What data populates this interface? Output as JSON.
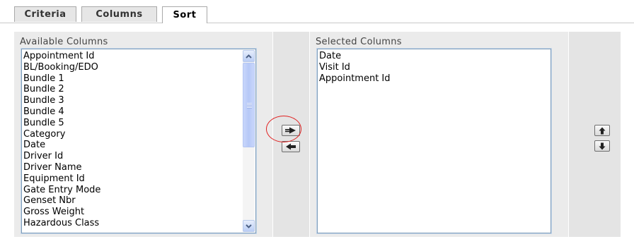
{
  "tabs": [
    {
      "label": "Criteria"
    },
    {
      "label": "Columns"
    },
    {
      "label": "Sort"
    }
  ],
  "active_tab": "Sort",
  "available": {
    "title": "Available Columns",
    "items": [
      "Appointment Id",
      "BL/Booking/EDO",
      "Bundle 1",
      "Bundle 2",
      "Bundle 3",
      "Bundle 4",
      "Bundle 5",
      "Category",
      "Date",
      "Driver Id",
      "Driver Name",
      "Equipment Id",
      "Gate Entry Mode",
      "Genset Nbr",
      "Gross Weight",
      "Hazardous Class"
    ]
  },
  "selected": {
    "title": "Selected Columns",
    "items": [
      "Date",
      "Visit Id",
      "Appointment Id"
    ]
  },
  "icons": {
    "add": "double-right-arrow-icon",
    "remove": "left-arrow-icon",
    "move_up": "up-arrow-icon",
    "move_down": "down-arrow-icon"
  },
  "colors": {
    "panel_bg": "#ebebeb",
    "listbox_border": "#7f9db9",
    "highlight_ring": "#e02020"
  }
}
